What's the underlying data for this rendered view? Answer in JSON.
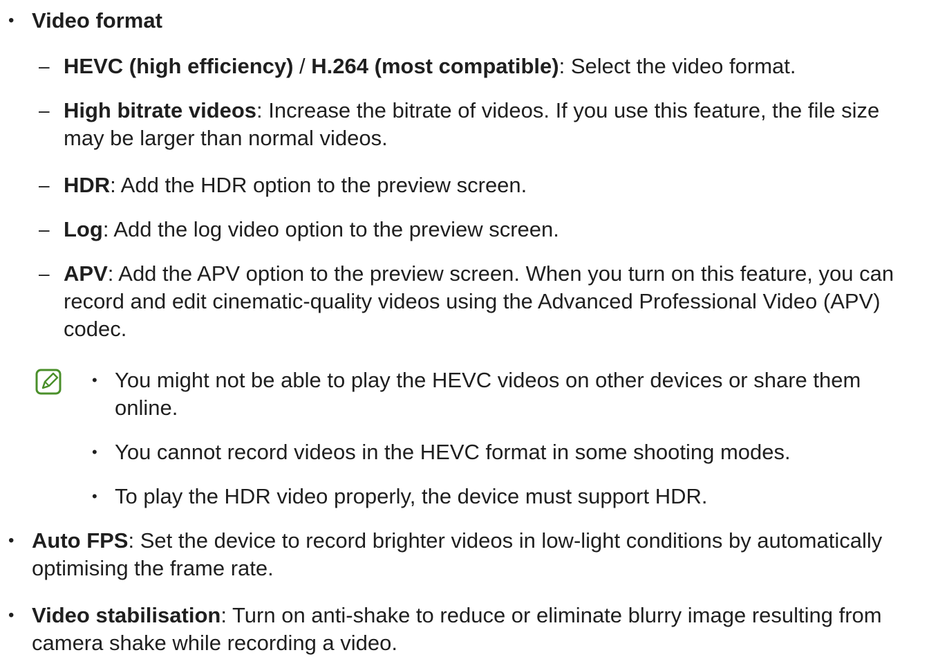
{
  "video_format": {
    "term": "Video format",
    "sub_items": [
      {
        "term": "HEVC (high efficiency)",
        "separator": " / ",
        "term2": "H.264 (most compatible)",
        "text": ": Select the video format."
      },
      {
        "term": "High bitrate videos",
        "text": ": Increase the bitrate of videos. If you use this feature, the file size may be larger than normal videos."
      },
      {
        "term": "HDR",
        "text": ": Add the HDR option to the preview screen."
      },
      {
        "term": "Log",
        "text": ": Add the log video option to the preview screen."
      },
      {
        "term": "APV",
        "text": ": Add the APV option to the preview screen. When you turn on this feature, you can record and edit cinematic-quality videos using the Advanced Professional Video (APV) codec."
      }
    ]
  },
  "notes": [
    "You might not be able to play the HEVC videos on other devices or share them online.",
    "You cannot record videos in the HEVC format in some shooting modes.",
    "To play the HDR video properly, the device must support HDR."
  ],
  "items": [
    {
      "term": "Auto FPS",
      "text": ": Set the device to record brighter videos in low-light conditions by automatically optimising the frame rate."
    },
    {
      "term": "Video stabilisation",
      "text": ": Turn on anti-shake to reduce or eliminate blurry image resulting from camera shake while recording a video."
    }
  ],
  "colors": {
    "text": "#1f1f1f",
    "note_icon": "#4a8f2a"
  },
  "icons": {
    "note": "note-icon"
  }
}
